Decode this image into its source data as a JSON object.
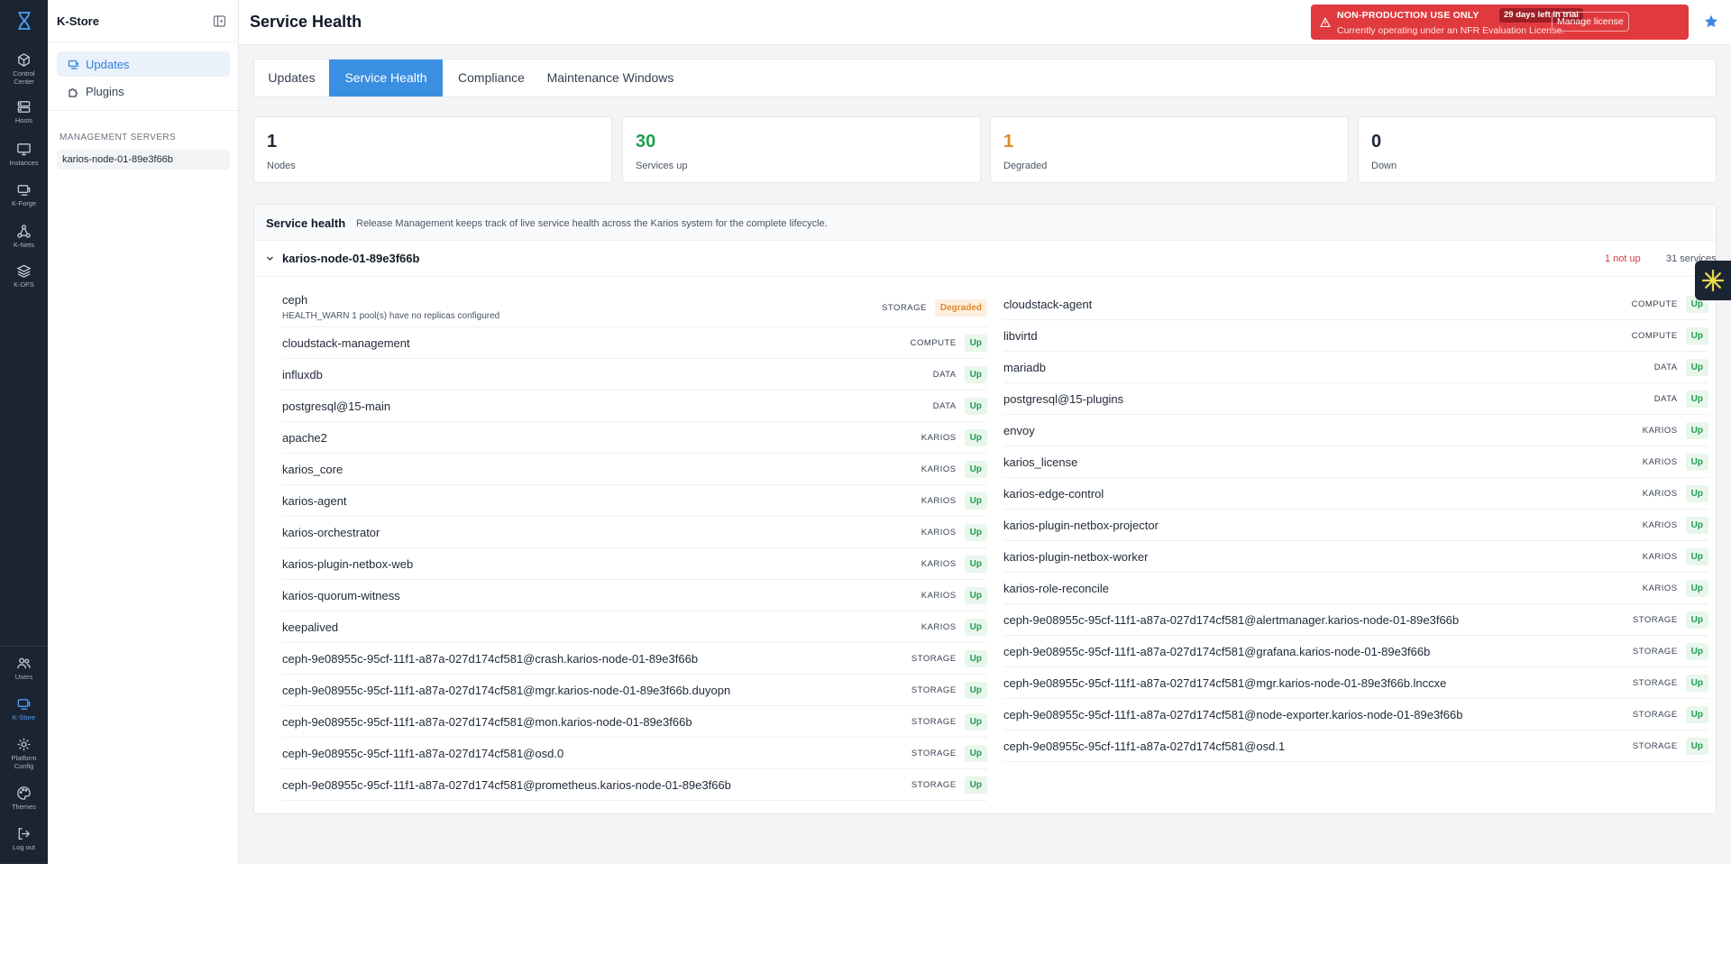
{
  "rail": {
    "items": [
      {
        "label": "Control\nCenter"
      },
      {
        "label": "Hosts"
      },
      {
        "label": "Instances"
      },
      {
        "label": "K-Forge"
      },
      {
        "label": "K-Nets"
      },
      {
        "label": "K-DFS"
      }
    ],
    "bottom_items": [
      {
        "label": "Users"
      },
      {
        "label": "K-Store"
      },
      {
        "label": "Platform\nConfig"
      },
      {
        "label": "Themes"
      },
      {
        "label": "Log out"
      }
    ],
    "active_color": "#4ea0f2"
  },
  "sidebar": {
    "title": "K-Store",
    "nav": [
      {
        "label": "Updates"
      },
      {
        "label": "Plugins"
      }
    ],
    "section_title": "MANAGEMENT SERVERS",
    "servers": [
      "karios-node-01-89e3f66b"
    ]
  },
  "header": {
    "title": "Service Health",
    "license": {
      "title": "NON-PRODUCTION USE ONLY",
      "trial": "29 days left in trial",
      "subtitle": "Currently operating under an NFR Evaluation License.",
      "manage": "Manage license",
      "color": "#e03a3e"
    }
  },
  "tabs": [
    "Updates",
    "Service Health",
    "Compliance",
    "Maintenance Windows"
  ],
  "stats": [
    {
      "value": "1",
      "label": "Nodes",
      "color": "#1f2937"
    },
    {
      "value": "30",
      "label": "Services up",
      "color": "#1f9d4d"
    },
    {
      "value": "1",
      "label": "Degraded",
      "color": "#dd8a2a"
    },
    {
      "value": "0",
      "label": "Down",
      "color": "#1f2937"
    }
  ],
  "health": {
    "title": "Service health",
    "description": "Release Management keeps track of live service health across the Karios system for the complete lifecycle.",
    "node": {
      "name": "karios-node-01-89e3f66b",
      "not_up": "1 not up",
      "count": "31 services"
    },
    "left": [
      {
        "name": "ceph",
        "detail": "HEALTH_WARN 1 pool(s) have no replicas configured",
        "category": "STORAGE",
        "status": "Degraded",
        "state": "degraded"
      },
      {
        "name": "cloudstack-management",
        "category": "COMPUTE",
        "status": "Up",
        "state": "up"
      },
      {
        "name": "influxdb",
        "category": "DATA",
        "status": "Up",
        "state": "up"
      },
      {
        "name": "postgresql@15-main",
        "category": "DATA",
        "status": "Up",
        "state": "up"
      },
      {
        "name": "apache2",
        "category": "KARIOS",
        "status": "Up",
        "state": "up"
      },
      {
        "name": "karios_core",
        "category": "KARIOS",
        "status": "Up",
        "state": "up"
      },
      {
        "name": "karios-agent",
        "category": "KARIOS",
        "status": "Up",
        "state": "up"
      },
      {
        "name": "karios-orchestrator",
        "category": "KARIOS",
        "status": "Up",
        "state": "up"
      },
      {
        "name": "karios-plugin-netbox-web",
        "category": "KARIOS",
        "status": "Up",
        "state": "up"
      },
      {
        "name": "karios-quorum-witness",
        "category": "KARIOS",
        "status": "Up",
        "state": "up"
      },
      {
        "name": "keepalived",
        "category": "KARIOS",
        "status": "Up",
        "state": "up"
      },
      {
        "name": "ceph-9e08955c-95cf-11f1-a87a-027d174cf581@crash.karios-node-01-89e3f66b",
        "category": "STORAGE",
        "status": "Up",
        "state": "up"
      },
      {
        "name": "ceph-9e08955c-95cf-11f1-a87a-027d174cf581@mgr.karios-node-01-89e3f66b.duyopn",
        "category": "STORAGE",
        "status": "Up",
        "state": "up"
      },
      {
        "name": "ceph-9e08955c-95cf-11f1-a87a-027d174cf581@mon.karios-node-01-89e3f66b",
        "category": "STORAGE",
        "status": "Up",
        "state": "up"
      },
      {
        "name": "ceph-9e08955c-95cf-11f1-a87a-027d174cf581@osd.0",
        "category": "STORAGE",
        "status": "Up",
        "state": "up"
      },
      {
        "name": "ceph-9e08955c-95cf-11f1-a87a-027d174cf581@prometheus.karios-node-01-89e3f66b",
        "category": "STORAGE",
        "status": "Up",
        "state": "up"
      }
    ],
    "right": [
      {
        "name": "cloudstack-agent",
        "category": "COMPUTE",
        "status": "Up",
        "state": "up"
      },
      {
        "name": "libvirtd",
        "category": "COMPUTE",
        "status": "Up",
        "state": "up"
      },
      {
        "name": "mariadb",
        "category": "DATA",
        "status": "Up",
        "state": "up"
      },
      {
        "name": "postgresql@15-plugins",
        "category": "DATA",
        "status": "Up",
        "state": "up"
      },
      {
        "name": "envoy",
        "category": "KARIOS",
        "status": "Up",
        "state": "up"
      },
      {
        "name": "karios_license",
        "category": "KARIOS",
        "status": "Up",
        "state": "up"
      },
      {
        "name": "karios-edge-control",
        "category": "KARIOS",
        "status": "Up",
        "state": "up"
      },
      {
        "name": "karios-plugin-netbox-projector",
        "category": "KARIOS",
        "status": "Up",
        "state": "up"
      },
      {
        "name": "karios-plugin-netbox-worker",
        "category": "KARIOS",
        "status": "Up",
        "state": "up"
      },
      {
        "name": "karios-role-reconcile",
        "category": "KARIOS",
        "status": "Up",
        "state": "up"
      },
      {
        "name": "ceph-9e08955c-95cf-11f1-a87a-027d174cf581@alertmanager.karios-node-01-89e3f66b",
        "category": "STORAGE",
        "status": "Up",
        "state": "up"
      },
      {
        "name": "ceph-9e08955c-95cf-11f1-a87a-027d174cf581@grafana.karios-node-01-89e3f66b",
        "category": "STORAGE",
        "status": "Up",
        "state": "up"
      },
      {
        "name": "ceph-9e08955c-95cf-11f1-a87a-027d174cf581@mgr.karios-node-01-89e3f66b.lnccxe",
        "category": "STORAGE",
        "status": "Up",
        "state": "up"
      },
      {
        "name": "ceph-9e08955c-95cf-11f1-a87a-027d174cf581@node-exporter.karios-node-01-89e3f66b",
        "category": "STORAGE",
        "status": "Up",
        "state": "up"
      },
      {
        "name": "ceph-9e08955c-95cf-11f1-a87a-027d174cf581@osd.1",
        "category": "STORAGE",
        "status": "Up",
        "state": "up"
      }
    ]
  }
}
